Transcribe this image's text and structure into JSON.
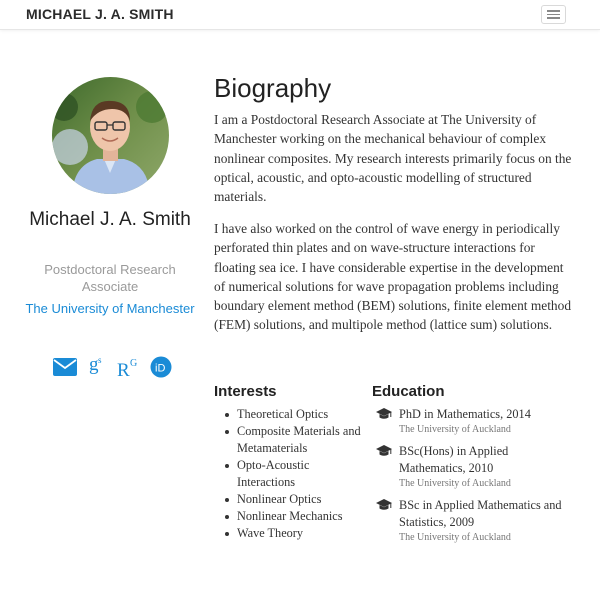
{
  "navbar": {
    "brand": "MICHAEL J. A. SMITH",
    "menu_icon": "hamburger-icon"
  },
  "profile": {
    "name": "Michael J. A. Smith",
    "role": "Postdoctoral Research Associate",
    "organization": "The University of Manchester",
    "social": [
      {
        "icon": "envelope-icon",
        "label": "Email"
      },
      {
        "icon": "google-scholar-icon",
        "label": "Google Scholar"
      },
      {
        "icon": "researchgate-icon",
        "label": "ResearchGate"
      },
      {
        "icon": "orcid-icon",
        "label": "ORCID"
      }
    ]
  },
  "bio": {
    "heading": "Biography",
    "paragraphs": [
      "I am a Postdoctoral Research Associate at The University of Manchester working on the mechanical behaviour of complex nonlinear composites. My research interests primarily focus on the optical, acoustic, and opto-acoustic modelling of structured materials.",
      "I have also worked on the control of wave energy in periodically perforated thin plates and on wave-structure interactions for floating sea ice. I have considerable expertise in the development of numerical solutions for wave propagation problems including boundary element method (BEM) solutions, finite element method (FEM) solutions, and multipole method (lattice sum) solutions."
    ]
  },
  "interests": {
    "heading": "Interests",
    "items": [
      "Theoretical Optics",
      "Composite Materials and Metamaterials",
      "Opto-Acoustic Interactions",
      "Nonlinear Optics",
      "Nonlinear Mechanics",
      "Wave Theory"
    ]
  },
  "education": {
    "heading": "Education",
    "icon": "graduation-cap-icon",
    "items": [
      {
        "course": "PhD in Mathematics, 2014",
        "institution": "The University of Auckland"
      },
      {
        "course": "BSc(Hons) in Applied Mathematics, 2010",
        "institution": "The University of Auckland"
      },
      {
        "course": "BSc in Applied Mathematics and Statistics, 2009",
        "institution": "The University of Auckland"
      }
    ]
  },
  "colors": {
    "accent": "#1a8bd6",
    "text": "#2b2b2b",
    "muted": "#9a9a9a"
  }
}
